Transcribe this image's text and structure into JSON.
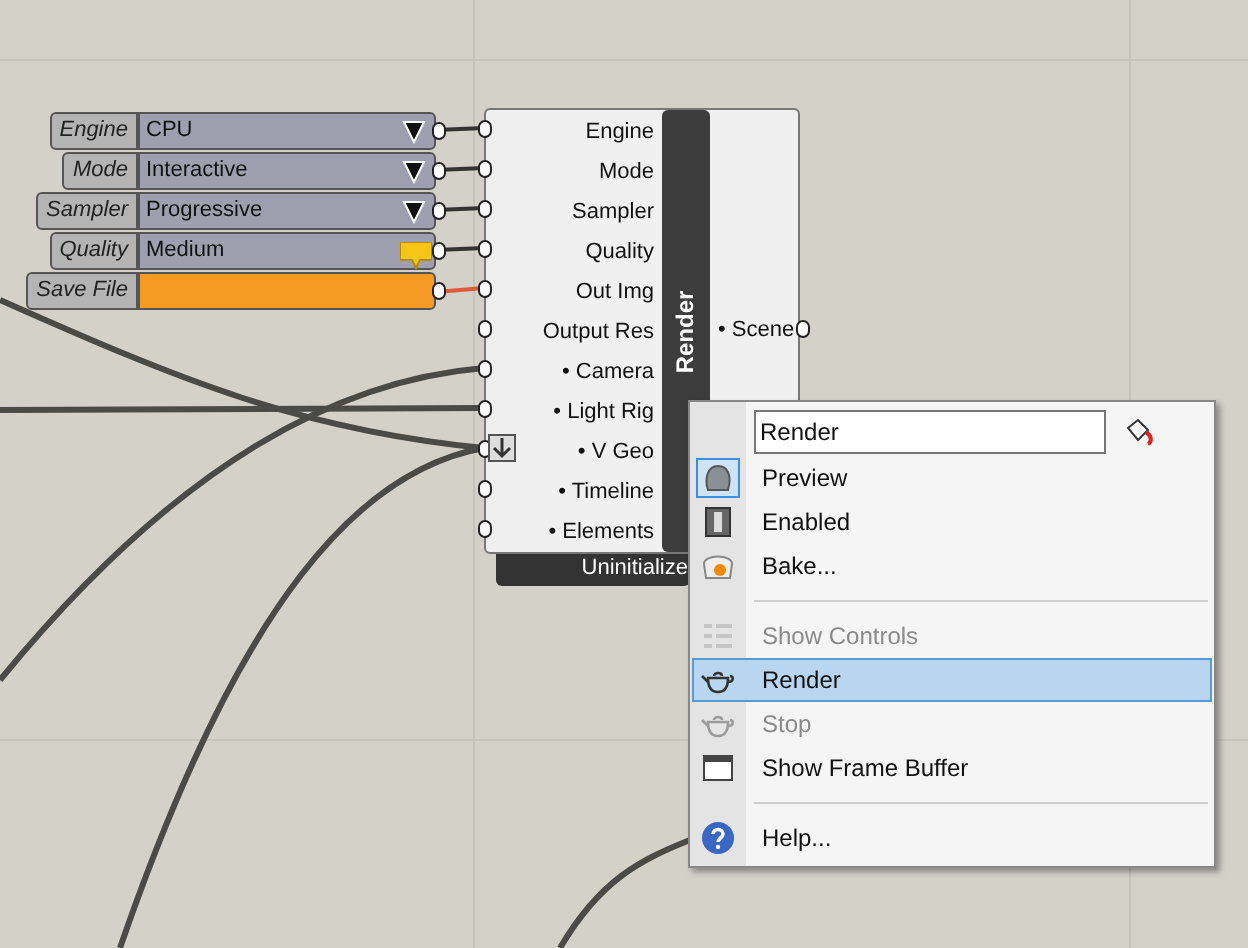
{
  "params": [
    {
      "label": "Engine",
      "value": "CPU",
      "kind": "dropdown"
    },
    {
      "label": "Mode",
      "value": "Interactive",
      "kind": "dropdown"
    },
    {
      "label": "Sampler",
      "value": "Progressive",
      "kind": "dropdown"
    },
    {
      "label": "Quality",
      "value": "Medium",
      "kind": "tag"
    },
    {
      "label": "Save File",
      "kind": "file"
    }
  ],
  "component": {
    "name": "Render",
    "status": "Uninitialize",
    "inputs": [
      "Engine",
      "Mode",
      "Sampler",
      "Quality",
      "Out Img",
      "Output Res",
      "• Camera",
      "• Light Rig",
      "• V Geo",
      "• Timeline",
      "• Elements"
    ],
    "outputs": [
      "• Scene"
    ]
  },
  "menu": {
    "name_field": "Render",
    "items": [
      {
        "kind": "item",
        "label": "Preview",
        "checked": true,
        "disabled": false,
        "selected": false
      },
      {
        "kind": "item",
        "label": "Enabled",
        "checked": false,
        "disabled": false,
        "selected": false
      },
      {
        "kind": "item",
        "label": "Bake...",
        "checked": false,
        "disabled": false,
        "selected": false
      },
      {
        "kind": "separator"
      },
      {
        "kind": "item",
        "label": "Show Controls",
        "checked": false,
        "disabled": true,
        "selected": false
      },
      {
        "kind": "item",
        "label": "Render",
        "checked": false,
        "disabled": false,
        "selected": true
      },
      {
        "kind": "item",
        "label": "Stop",
        "checked": false,
        "disabled": true,
        "selected": false
      },
      {
        "kind": "item",
        "label": "Show Frame Buffer",
        "checked": false,
        "disabled": false,
        "selected": false
      },
      {
        "kind": "separator"
      },
      {
        "kind": "item",
        "label": "Help...",
        "checked": false,
        "disabled": false,
        "selected": false
      }
    ]
  }
}
